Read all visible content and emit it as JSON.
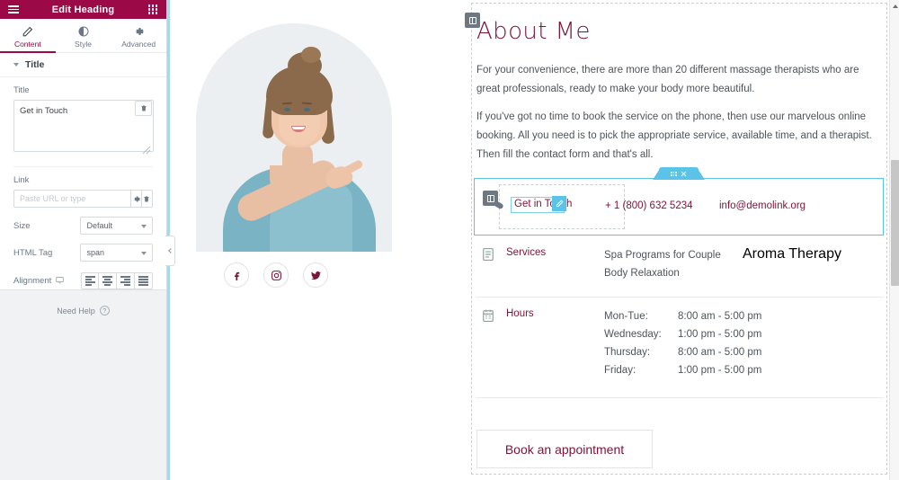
{
  "panel": {
    "header": {
      "title": "Edit Heading",
      "menu_icon": "hamburger-menu-icon",
      "apps_icon": "grid-apps-icon"
    },
    "tabs": [
      {
        "label": "Content",
        "icon": "pencil-icon",
        "active": true
      },
      {
        "label": "Style",
        "icon": "contrast-circle-icon",
        "active": false
      },
      {
        "label": "Advanced",
        "icon": "gear-icon",
        "active": false
      }
    ],
    "section": {
      "label": "Title",
      "collapsed": false
    },
    "fields": {
      "title": {
        "label": "Title",
        "value": "Get in Touch",
        "delete_icon": "trash-icon",
        "resize_icon": "resize-grip-icon"
      },
      "link": {
        "label": "Link",
        "value": "",
        "placeholder": "Paste URL or type",
        "settings_icon": "gear-icon",
        "delete_icon": "trash-icon"
      },
      "size": {
        "label": "Size",
        "value": "Default"
      },
      "html_tag": {
        "label": "HTML Tag",
        "value": "span"
      },
      "alignment": {
        "label": "Alignment",
        "device_icon": "desktop-icon",
        "options": [
          "align-left",
          "align-center",
          "align-right",
          "align-justify"
        ]
      }
    },
    "need_help": {
      "label": "Need Help",
      "icon": "question-circle-icon"
    },
    "collapse_handle_icon": "chevron-left-icon"
  },
  "canvas": {
    "photo": {
      "alt": "woman-pointing-right-photo",
      "handle_icon": "widget-handle-icon"
    },
    "socials": [
      {
        "name": "facebook-icon",
        "glyph": "f"
      },
      {
        "name": "instagram-icon",
        "glyph": ""
      },
      {
        "name": "twitter-icon",
        "glyph": ""
      }
    ],
    "about": {
      "handle_icon": "widget-handle-icon",
      "heading": "About Me",
      "paragraph_1": "For your convenience, there are more than 20 different massage therapists who are great professionals, ready to make your body more beautiful.",
      "paragraph_2": "If you've got no time to book the service on the phone, then use our marvelous online booking. All you need is to pick the appropriate service, available time, and a therapist. Then fill the contact form and that's all."
    },
    "contact_section": {
      "selected": true,
      "tab_icons": {
        "drag": "drag-dots-icon",
        "close": "close-x-icon"
      },
      "widget_handle_icon": "widget-handle-icon",
      "heading": "Get in Touch",
      "edit_badge_icon": "pencil-edit-icon",
      "phone": "+ 1 (800) 632 5234",
      "email": "info@demolink.org"
    },
    "info_blocks": [
      {
        "icon": "document-list-icon",
        "name": "Services",
        "column_1": [
          "Spa Programs for Couple",
          "Body Relaxation"
        ],
        "column_2": [
          "Aroma Therapy"
        ]
      },
      {
        "icon": "calendar-icon",
        "name": "Hours",
        "rows": [
          {
            "day": "Mon-Tue:",
            "time": "8:00 am - 5:00 pm"
          },
          {
            "day": "Wednesday:",
            "time": "1:00 pm - 5:00 pm"
          },
          {
            "day": "Thursday:",
            "time": "8:00 am - 5:00 pm"
          },
          {
            "day": "Friday:",
            "time": "1:00 pm - 5:00 pm"
          }
        ]
      }
    ],
    "book_button": {
      "label": "Book an appointment"
    }
  },
  "scrollbar": {
    "up_arrow_icon": "scroll-up-arrow-icon",
    "thumb": "scroll-thumb"
  },
  "colors": {
    "brand_maroon": "#9b0a46",
    "heading_maroon": "#7a1438",
    "selection_blue": "#5cc3e8",
    "panel_bg": "#f1f2f3",
    "body_text": "#4d5459"
  }
}
